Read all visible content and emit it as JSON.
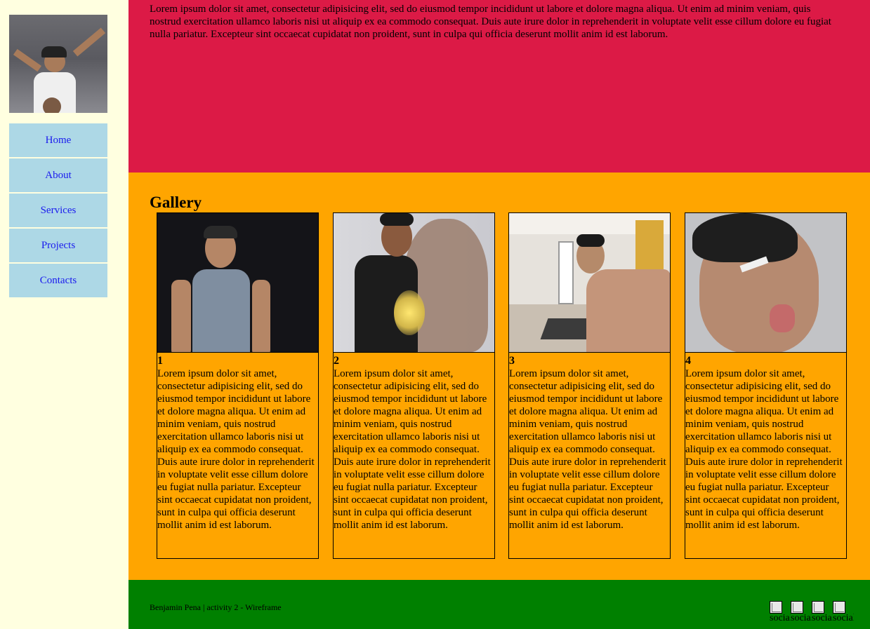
{
  "sidebar": {
    "nav": [
      "Home",
      "About",
      "Services",
      "Projects",
      "Contacts"
    ]
  },
  "header": {
    "text": "Lorem ipsum dolor sit amet, consectetur adipisicing elit, sed do eiusmod tempor incididunt ut labore et dolore magna aliqua. Ut enim ad minim veniam, quis nostrud exercitation ullamco laboris nisi ut aliquip ex ea commodo consequat. Duis aute irure dolor in reprehenderit in voluptate velit esse cillum dolore eu fugiat nulla pariatur. Excepteur sint occaecat cupidatat non proident, sunt in culpa qui officia deserunt mollit anim id est laborum."
  },
  "gallery": {
    "title": "Gallery",
    "cards": [
      {
        "num": "1",
        "text": "Lorem ipsum dolor sit amet, consectetur adipisicing elit, sed do eiusmod tempor incididunt ut labore et dolore magna aliqua. Ut enim ad minim veniam, quis nostrud exercitation ullamco laboris nisi ut aliquip ex ea commodo consequat. Duis aute irure dolor in reprehenderit in voluptate velit esse cillum dolore eu fugiat nulla pariatur. Excepteur sint occaecat cupidatat non proident, sunt in culpa qui officia deserunt mollit anim id est laborum."
      },
      {
        "num": "2",
        "text": "Lorem ipsum dolor sit amet, consectetur adipisicing elit, sed do eiusmod tempor incididunt ut labore et dolore magna aliqua. Ut enim ad minim veniam, quis nostrud exercitation ullamco laboris nisi ut aliquip ex ea commodo consequat. Duis aute irure dolor in reprehenderit in voluptate velit esse cillum dolore eu fugiat nulla pariatur. Excepteur sint occaecat cupidatat non proident, sunt in culpa qui officia deserunt mollit anim id est laborum."
      },
      {
        "num": "3",
        "text": "Lorem ipsum dolor sit amet, consectetur adipisicing elit, sed do eiusmod tempor incididunt ut labore et dolore magna aliqua. Ut enim ad minim veniam, quis nostrud exercitation ullamco laboris nisi ut aliquip ex ea commodo consequat. Duis aute irure dolor in reprehenderit in voluptate velit esse cillum dolore eu fugiat nulla pariatur. Excepteur sint occaecat cupidatat non proident, sunt in culpa qui officia deserunt mollit anim id est laborum."
      },
      {
        "num": "4",
        "text": "Lorem ipsum dolor sit amet, consectetur adipisicing elit, sed do eiusmod tempor incididunt ut labore et dolore magna aliqua. Ut enim ad minim veniam, quis nostrud exercitation ullamco laboris nisi ut aliquip ex ea commodo consequat. Duis aute irure dolor in reprehenderit in voluptate velit esse cillum dolore eu fugiat nulla pariatur. Excepteur sint occaecat cupidatat non proident, sunt in culpa qui officia deserunt mollit anim id est laborum."
      }
    ]
  },
  "footer": {
    "credit": "Benjamin Pena | activity 2 - Wireframe",
    "social_alts": [
      "social-",
      "social-",
      "social-",
      "social-"
    ]
  },
  "colors": {
    "sidebar_bg": "#ffffe0",
    "nav_bg": "#add8e6",
    "header_bg": "#dc1a46",
    "gallery_bg": "#ffa500",
    "footer_bg": "#008000"
  }
}
